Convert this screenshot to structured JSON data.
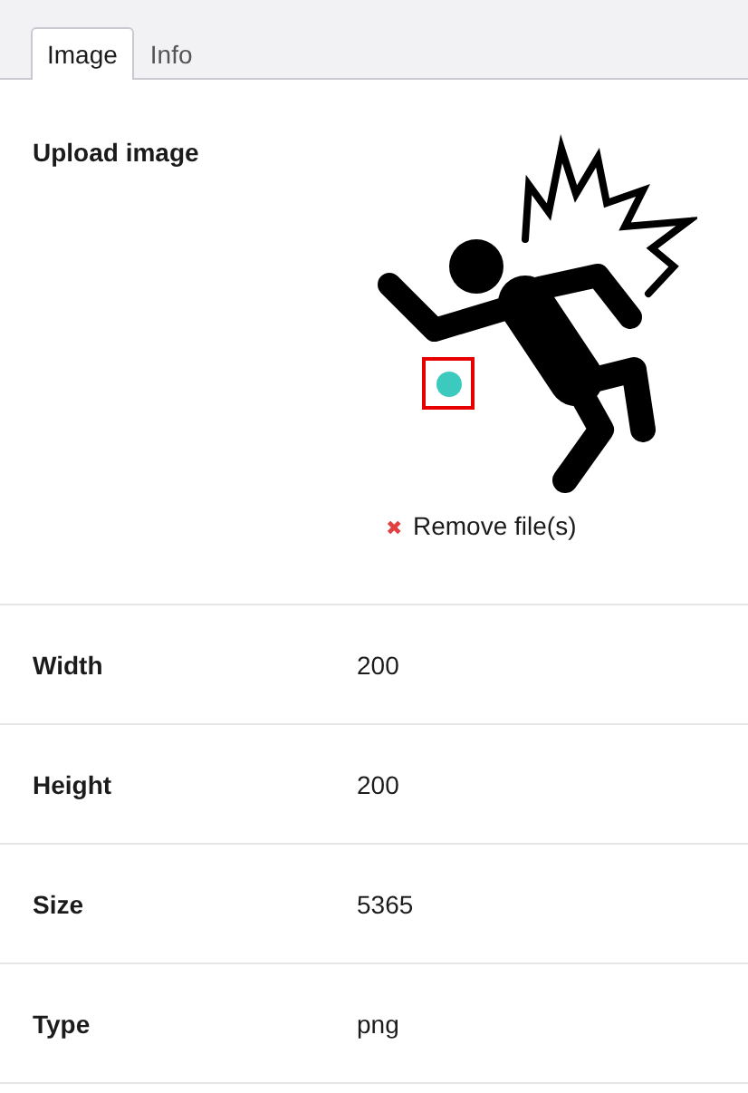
{
  "tabs": [
    {
      "label": "Image",
      "selected": true
    },
    {
      "label": "Info",
      "selected": false
    }
  ],
  "upload": {
    "label": "Upload image",
    "remove_icon": "✖",
    "remove_label": "Remove file(s)"
  },
  "fields": [
    {
      "label": "Width",
      "value": "200"
    },
    {
      "label": "Height",
      "value": "200"
    },
    {
      "label": "Size",
      "value": "5365"
    },
    {
      "label": "Type",
      "value": "png"
    }
  ]
}
